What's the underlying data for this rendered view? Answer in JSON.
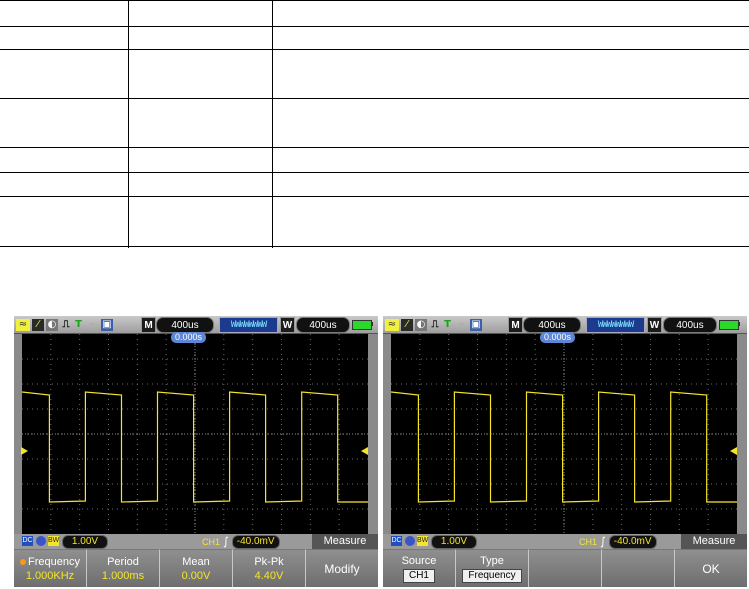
{
  "scopes": [
    {
      "topbar": {
        "mode_box": "M",
        "main_timebase": "400us",
        "window_box": "W",
        "window_timebase": "400us"
      },
      "time_offset": "0.000s",
      "status": {
        "coupling": "DC",
        "bw_limit": "BW",
        "volts_per_div": "1.00V",
        "trigger_channel": "CH1",
        "trigger_level": "-40.0mV",
        "menu_title": "Measure"
      },
      "softkeys": [
        {
          "label": "Frequency",
          "value": "1.000KHz"
        },
        {
          "label": "Period",
          "value": "1.000ms"
        },
        {
          "label": "Mean",
          "value": "0.00V"
        },
        {
          "label": "Pk-Pk",
          "value": "4.40V"
        },
        {
          "label": "Modify",
          "value": ""
        }
      ]
    },
    {
      "topbar": {
        "mode_box": "M",
        "main_timebase": "400us",
        "window_box": "W",
        "window_timebase": "400us"
      },
      "time_offset": "0.000s",
      "status": {
        "coupling": "DC",
        "bw_limit": "BW",
        "volts_per_div": "1.00V",
        "trigger_channel": "CH1",
        "trigger_level": "-40.0mV",
        "menu_title": "Measure"
      },
      "softkeys": [
        {
          "label": "Source",
          "value": "CH1"
        },
        {
          "label": "Type",
          "value": "Frequency"
        },
        {
          "label": "",
          "value": ""
        },
        {
          "label": "",
          "value": ""
        },
        {
          "label": "OK",
          "value": ""
        }
      ]
    }
  ],
  "colors": {
    "trace": "#f5e52a",
    "grid": "#6a6a6a",
    "accent": "#5d86d6"
  }
}
